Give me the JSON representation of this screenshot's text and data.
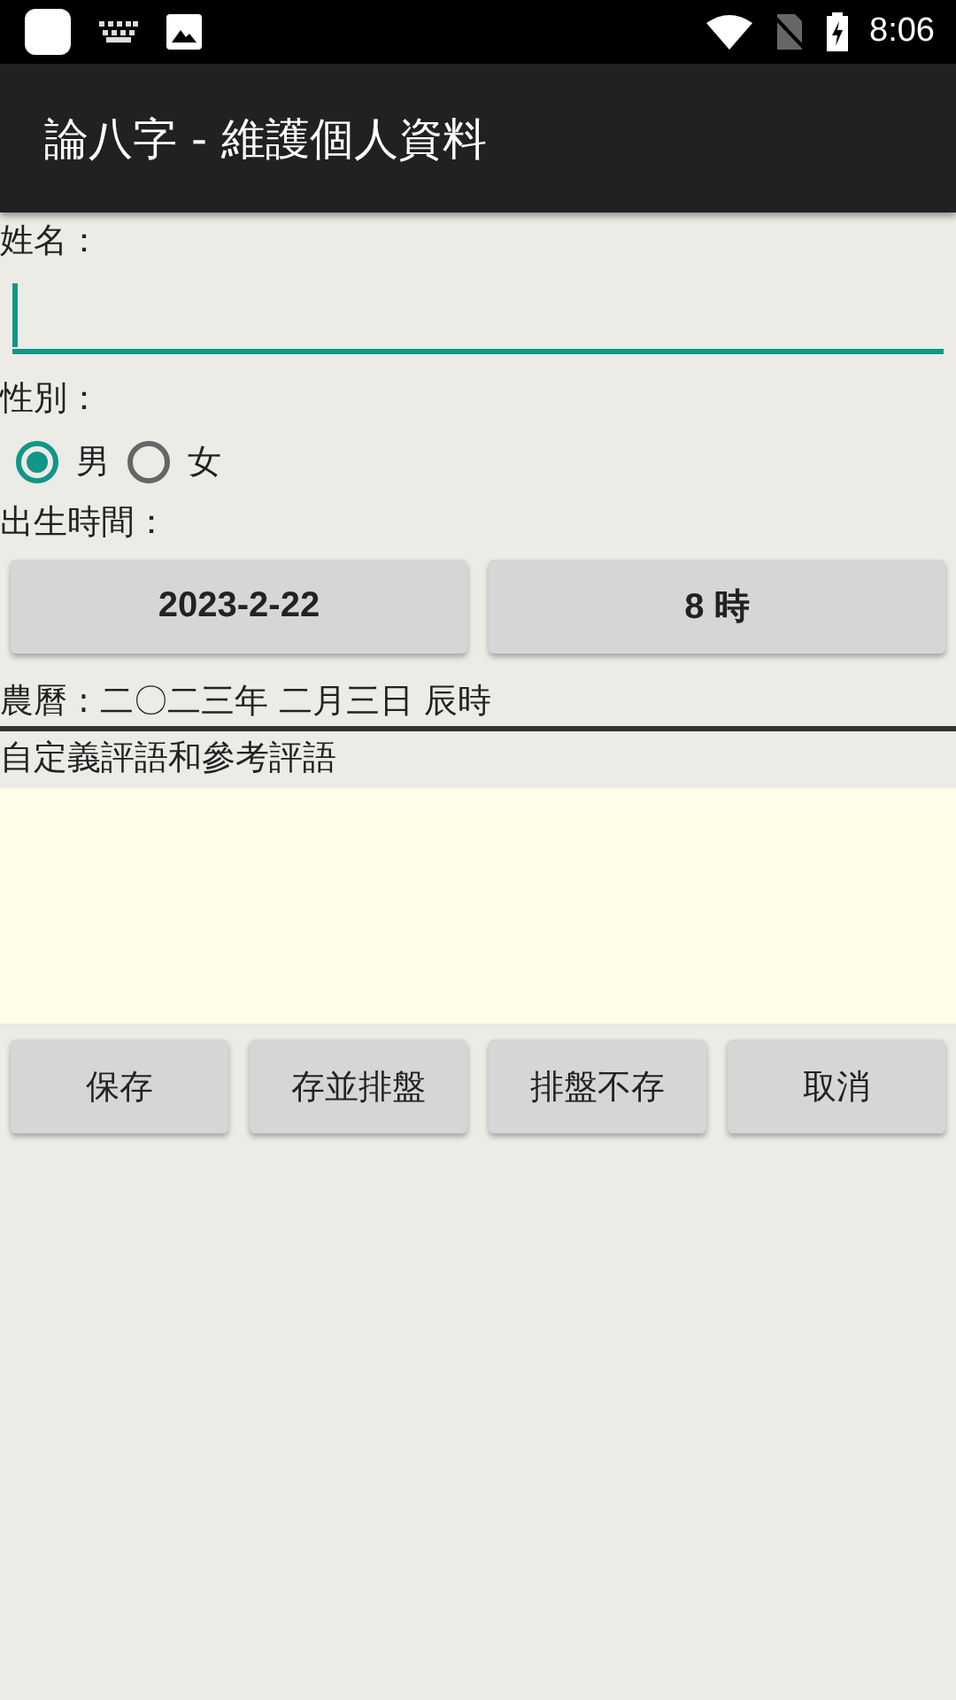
{
  "status_bar": {
    "time": "8:06"
  },
  "app_bar": {
    "title": "論八字 - 維護個人資料"
  },
  "name": {
    "label": "姓名："
  },
  "gender": {
    "label": "性別：",
    "options": [
      {
        "label": "男",
        "selected": true
      },
      {
        "label": "女",
        "selected": false
      }
    ]
  },
  "birth": {
    "label": "出生時間：",
    "date_button": "2023-2-22",
    "hour_button": "8 時"
  },
  "lunar_text": "農曆 : 二〇二三年 二月三日 辰時",
  "comment": {
    "label": "自定義評語和參考評語"
  },
  "buttons": [
    "保存",
    "存並排盤",
    "排盤不存",
    "取消"
  ]
}
